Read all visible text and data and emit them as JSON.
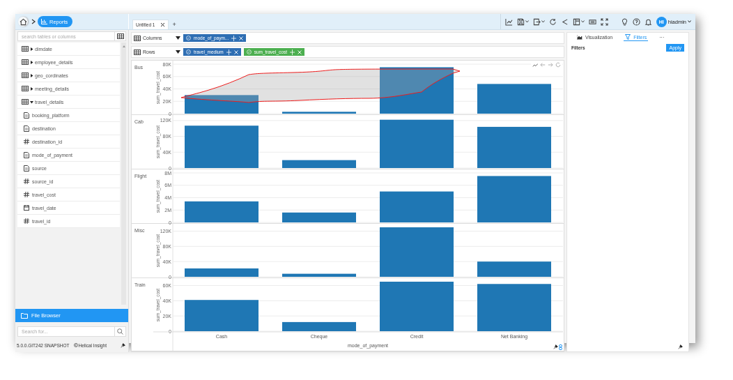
{
  "breadcrumb": {
    "current": "Reports"
  },
  "tabs": [
    {
      "label": "Untitled 1",
      "selected": true
    }
  ],
  "new_tab": "+",
  "user": {
    "initials": "HI",
    "name": "hiadmin"
  },
  "sidebar": {
    "search": {
      "placeholder": "search tables or columns"
    },
    "items": [
      {
        "label": "dimdate",
        "kind": "table",
        "expanded": false
      },
      {
        "label": "employee_details",
        "kind": "table",
        "expanded": false
      },
      {
        "label": "geo_cordinates",
        "kind": "table",
        "expanded": false
      },
      {
        "label": "meeting_details",
        "kind": "table",
        "expanded": false
      },
      {
        "label": "travel_details",
        "kind": "table",
        "expanded": true,
        "children": [
          {
            "label": "booking_platform",
            "kind": "text"
          },
          {
            "label": "destination",
            "kind": "text"
          },
          {
            "label": "destination_id",
            "kind": "number"
          },
          {
            "label": "mode_of_payment",
            "kind": "text"
          },
          {
            "label": "source",
            "kind": "text"
          },
          {
            "label": "source_id",
            "kind": "number"
          },
          {
            "label": "travel_cost",
            "kind": "number"
          },
          {
            "label": "travel_date",
            "kind": "date"
          },
          {
            "label": "travel_id",
            "kind": "number"
          }
        ]
      }
    ],
    "file_browser": "File Browser",
    "file_search": {
      "placeholder": "Search for..."
    },
    "version": "5.0.0.GIT242 SNAPSHOT",
    "brand": "Helical Insight"
  },
  "shelves": [
    {
      "label": "Columns",
      "pills": [
        {
          "label": "mode_of_paym...",
          "color": "#2e6eb3"
        }
      ]
    },
    {
      "label": "Rows",
      "pills": [
        {
          "label": "travel_medium",
          "color": "#2e6eb3"
        },
        {
          "label": "sum_travel_cost",
          "color": "#4caf50"
        }
      ]
    }
  ],
  "charts": [
    {
      "label": "Bus",
      "chart_data": {
        "type": "bar",
        "grid": true,
        "ylabel": "sum_travel_cost",
        "values": [
          30000,
          3000,
          75000,
          48000
        ],
        "ylim": [
          0,
          80000
        ],
        "yticks": [
          {
            "value": 0,
            "label": "0"
          },
          {
            "value": 20000,
            "label": "20K"
          },
          {
            "value": 40000,
            "label": "40K"
          },
          {
            "value": 60000,
            "label": "60K"
          },
          {
            "value": 80000,
            "label": "80K"
          }
        ]
      }
    },
    {
      "label": "Cab",
      "chart_data": {
        "type": "bar",
        "grid": true,
        "ylabel": "sum_travel_cost",
        "values": [
          107000,
          20000,
          122000,
          104000
        ],
        "ylim": [
          0,
          125000
        ],
        "yticks": [
          {
            "value": 0,
            "label": "0"
          },
          {
            "value": 40000,
            "label": "40K"
          },
          {
            "value": 80000,
            "label": "80K"
          },
          {
            "value": 120000,
            "label": "120K"
          }
        ]
      }
    },
    {
      "label": "Flight",
      "chart_data": {
        "type": "bar",
        "grid": true,
        "ylabel": "sum_travel_cost",
        "values": [
          3400000,
          1600000,
          5000000,
          7500000
        ],
        "ylim": [
          0,
          8000000
        ],
        "yticks": [
          {
            "value": 0,
            "label": "0"
          },
          {
            "value": 2000000,
            "label": "2M"
          },
          {
            "value": 4000000,
            "label": "4M"
          },
          {
            "value": 6000000,
            "label": "6M"
          },
          {
            "value": 8000000,
            "label": "8M"
          }
        ]
      }
    },
    {
      "label": "Misc",
      "chart_data": {
        "type": "bar",
        "grid": true,
        "ylabel": "sum_travel_cost",
        "values": [
          22000,
          8000,
          130000,
          40000
        ],
        "ylim": [
          0,
          130000
        ],
        "yticks": [
          {
            "value": 0,
            "label": "0"
          },
          {
            "value": 40000,
            "label": "40K"
          },
          {
            "value": 80000,
            "label": "80K"
          },
          {
            "value": 120000,
            "label": "120K"
          }
        ]
      }
    },
    {
      "label": "Train",
      "chart_data": {
        "type": "bar",
        "grid": true,
        "ylabel": "sum_travel_cost",
        "xlabel": "mode_of_payment",
        "categories": [
          "Cash",
          "Cheque",
          "Credit",
          "Net Banking"
        ],
        "values": [
          41000,
          12000,
          65000,
          62000
        ],
        "ylim": [
          0,
          65000
        ],
        "yticks": [
          {
            "value": 0,
            "label": "0"
          },
          {
            "value": 20000,
            "label": "20K"
          },
          {
            "value": 40000,
            "label": "40K"
          },
          {
            "value": 60000,
            "label": "60K"
          }
        ]
      }
    }
  ],
  "right_panel": {
    "tabs": [
      {
        "label": "Visualization",
        "selected": false
      },
      {
        "label": "Filters",
        "selected": true
      },
      {
        "label": "···",
        "selected": false
      }
    ],
    "heading": "Filters",
    "apply": "Apply"
  }
}
